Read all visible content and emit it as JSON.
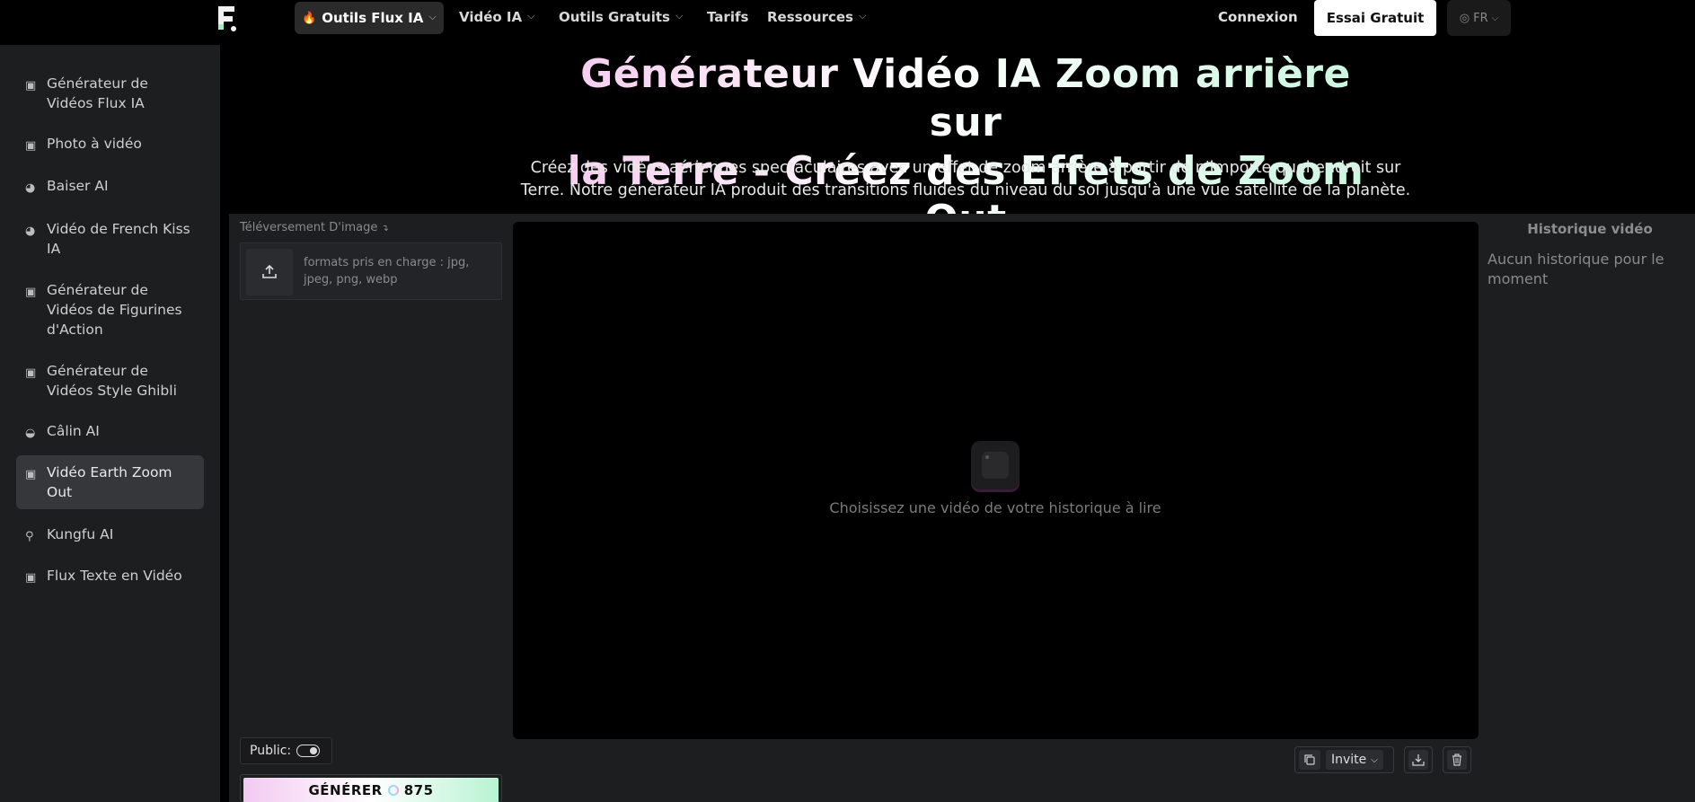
{
  "header": {
    "nav": [
      {
        "label": "Outils Flux IA",
        "active": true,
        "icon": "flame-icon"
      },
      {
        "label": "Vidéo IA",
        "active": false
      },
      {
        "label": "Outils Gratuits",
        "active": false
      },
      {
        "label": "Tarifs",
        "active": false
      },
      {
        "label": "Ressources",
        "active": false
      }
    ],
    "login_label": "Connexion",
    "trial_label": "Essai Gratuit",
    "lang_label": "FR"
  },
  "sidebar": {
    "items": [
      {
        "label": "Générateur de Vidéos Flux IA",
        "icon": "video-icon"
      },
      {
        "label": "Photo à vidéo",
        "icon": "video-icon"
      },
      {
        "label": "Baiser AI",
        "icon": "kiss-icon"
      },
      {
        "label": "Vidéo de French Kiss IA",
        "icon": "kiss-icon"
      },
      {
        "label": "Générateur de Vidéos de Figurines d'Action",
        "icon": "video-icon"
      },
      {
        "label": "Générateur de Vidéos Style Ghibli",
        "icon": "video-icon"
      },
      {
        "label": "Câlin AI",
        "icon": "hug-icon"
      },
      {
        "label": "Vidéo Earth Zoom Out",
        "icon": "video-icon",
        "active": true
      },
      {
        "label": "Kungfu AI",
        "icon": "kungfu-icon"
      },
      {
        "label": "Flux Texte en Vidéo",
        "icon": "video-icon"
      }
    ]
  },
  "hero": {
    "title_line1": "Générateur Vidéo IA Zoom arrière sur",
    "title_line2": "la Terre - Créez des Effets de Zoom Out",
    "subtitle_line1": "Créez des vidéos aériennes spectaculaires avec un effet de zoom arrière à partir de n'importe quel endroit sur",
    "subtitle_line2": "Terre. Notre générateur IA produit des transitions fluides du niveau du sol jusqu'à une vue satellite de la planète."
  },
  "upload": {
    "label": "Téléversement D'image",
    "hint": "formats pris en charge : jpg, jpeg, png, webp"
  },
  "player": {
    "placeholder": "Choisissez une vidéo de votre historique à lire"
  },
  "history": {
    "title": "Historique vidéo",
    "empty": "Aucun historique pour le moment"
  },
  "controls": {
    "public_label": "Public:",
    "public_on": true,
    "generate_label": "GÉNÉRER",
    "credits": "875",
    "invite_label": "Invite"
  }
}
